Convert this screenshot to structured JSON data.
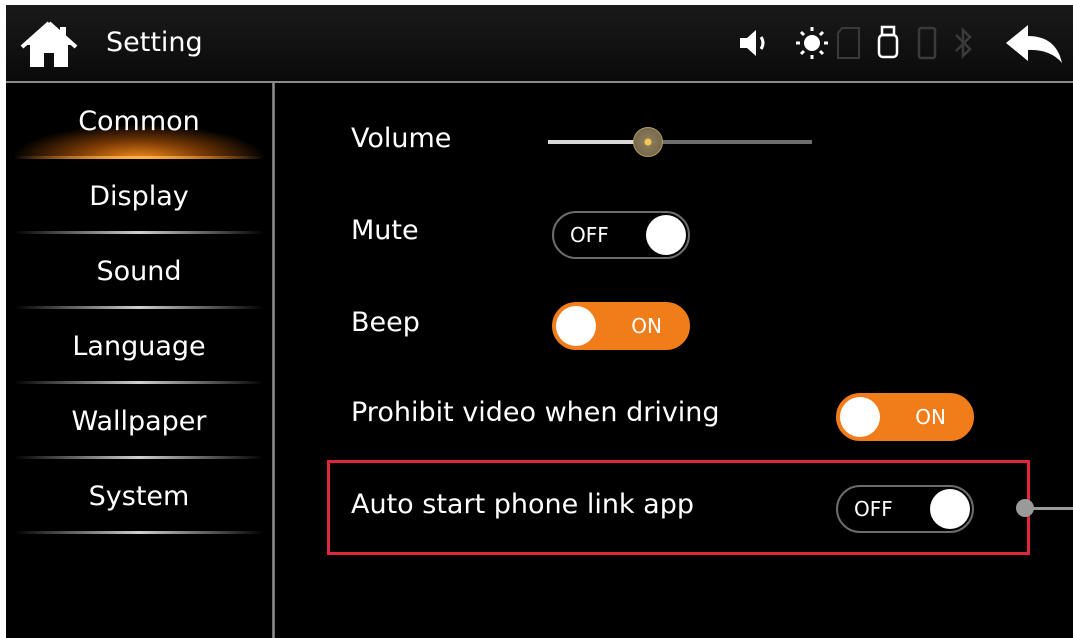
{
  "header": {
    "title": "Setting",
    "icons": [
      "home-icon",
      "volume-icon",
      "brightness-icon",
      "sd-card-icon",
      "usb-icon",
      "phone-icon",
      "bluetooth-icon",
      "back-icon"
    ]
  },
  "sidebar": {
    "items": [
      {
        "label": "Common",
        "active": true
      },
      {
        "label": "Display"
      },
      {
        "label": "Sound"
      },
      {
        "label": "Language"
      },
      {
        "label": "Wallpaper"
      },
      {
        "label": "System"
      }
    ]
  },
  "settings": {
    "volume": {
      "label": "Volume",
      "level": 0.38
    },
    "mute": {
      "label": "Mute",
      "state": "OFF"
    },
    "beep": {
      "label": "Beep",
      "state": "ON"
    },
    "prohibit_video": {
      "label": "Prohibit video when driving",
      "state": "ON"
    },
    "auto_start": {
      "label": "Auto start phone link app",
      "state": "OFF"
    }
  },
  "colors": {
    "accent": "#f07c1a",
    "highlight": "#e0263a",
    "background": "#000000"
  }
}
